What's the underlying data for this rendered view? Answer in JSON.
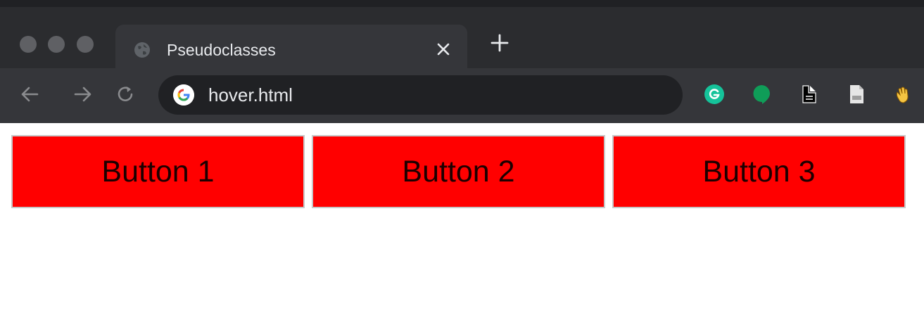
{
  "window": {
    "tab": {
      "title": "Pseudoclasses",
      "favicon": "globe-icon"
    },
    "new_tab_icon": "plus-icon"
  },
  "toolbar": {
    "back_icon": "back-arrow-icon",
    "forward_icon": "forward-arrow-icon",
    "reload_icon": "reload-icon",
    "omnibox": {
      "site_icon": "google-icon",
      "url": "hover.html"
    },
    "extensions": [
      {
        "name": "grammarly-icon",
        "color": "#15c39a"
      },
      {
        "name": "hangouts-icon",
        "color": "#0f9d58"
      },
      {
        "name": "document-icon",
        "color": "#000000"
      },
      {
        "name": "page-icon",
        "color": "#e0e0e0"
      },
      {
        "name": "waving-hand-icon",
        "color": "#f5c542"
      }
    ]
  },
  "page": {
    "buttons": [
      {
        "label": "Button 1"
      },
      {
        "label": "Button 2"
      },
      {
        "label": "Button 3"
      }
    ],
    "button_color": "#ff0000"
  }
}
